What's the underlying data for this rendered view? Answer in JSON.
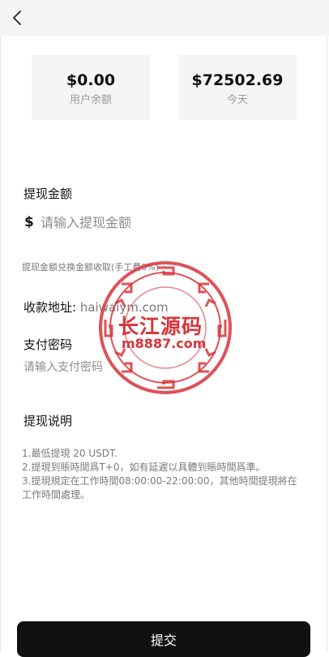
{
  "balance_cards": [
    {
      "value": "$0.00",
      "label": "用户余额"
    },
    {
      "value": "$72502.69",
      "label": "今天"
    }
  ],
  "withdraw": {
    "amount_label": "提现金额",
    "currency_symbol": "$",
    "amount_placeholder": "请输入提现金额",
    "fee_note": "提现金额兑换金额收取(手工费0%)",
    "address_label": "收款地址:",
    "address_value": "haiwaiym.com",
    "password_label": "支付密码",
    "password_placeholder": "请输入支付密码"
  },
  "instructions": {
    "title": "提现说明",
    "lines": [
      "1.最低提現 20 USDT.",
      "2.提現到賬時間爲T+0，如有延遲以具體到賬時間爲準。",
      "3.提現規定在工作時間08:00:00-22:00:00，其他時間提現將在",
      "工作時間處理。"
    ]
  },
  "submit_label": "提交",
  "watermark": {
    "line1": "长江源码",
    "line2": "m8887.com"
  },
  "colors": {
    "stamp": "#d9333a",
    "button": "#111111"
  }
}
